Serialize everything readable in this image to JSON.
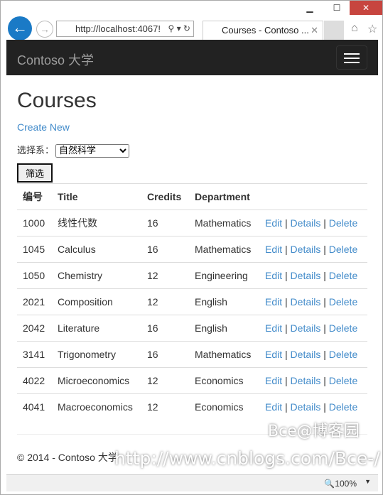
{
  "browser": {
    "url": "http://localhost:4067!",
    "tab_title": "Courses - Contoso ...",
    "zoom": "100%"
  },
  "nav": {
    "brand": "Contoso 大学"
  },
  "main": {
    "title": "Courses",
    "create_new": "Create New",
    "filter_label": "选择系：",
    "filter_selected": "自然科学",
    "filter_button": "筛选",
    "columns": [
      "编号",
      "Title",
      "Credits",
      "Department"
    ],
    "actions": {
      "edit": "Edit",
      "details": "Details",
      "delete": "Delete",
      "sep": "|"
    },
    "rows": [
      {
        "id": "1000",
        "title": "线性代数",
        "credits": "16",
        "dept": "Mathematics"
      },
      {
        "id": "1045",
        "title": "Calculus",
        "credits": "16",
        "dept": "Mathematics"
      },
      {
        "id": "1050",
        "title": "Chemistry",
        "credits": "12",
        "dept": "Engineering"
      },
      {
        "id": "2021",
        "title": "Composition",
        "credits": "12",
        "dept": "English"
      },
      {
        "id": "2042",
        "title": "Literature",
        "credits": "16",
        "dept": "English"
      },
      {
        "id": "3141",
        "title": "Trigonometry",
        "credits": "16",
        "dept": "Mathematics"
      },
      {
        "id": "4022",
        "title": "Microeconomics",
        "credits": "12",
        "dept": "Economics"
      },
      {
        "id": "4041",
        "title": "Macroeconomics",
        "credits": "12",
        "dept": "Economics"
      }
    ]
  },
  "footer": {
    "text": "© 2014 - Contoso 大学"
  },
  "watermark": {
    "line1": "Bce@博客园",
    "line2": "http://www.cnblogs.com/Bce-/"
  }
}
